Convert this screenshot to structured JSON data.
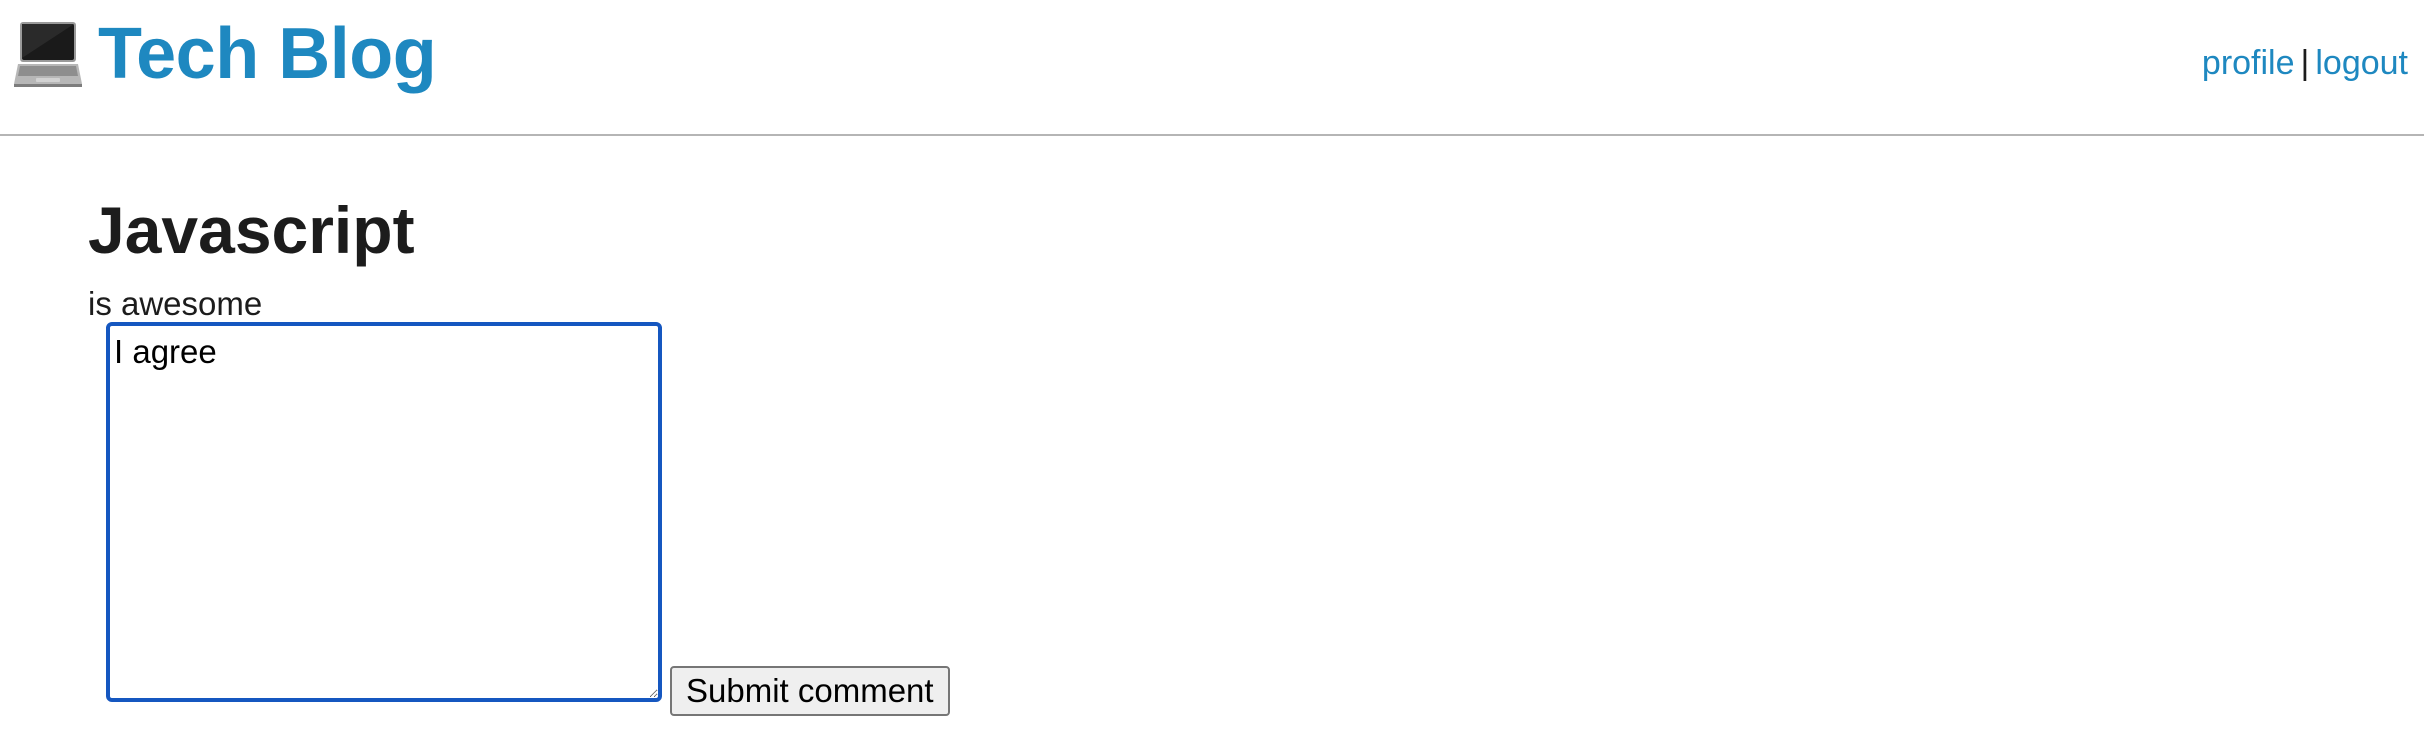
{
  "header": {
    "brand_icon": "laptop-icon",
    "brand_title": "Tech Blog",
    "nav": {
      "profile_label": "profile",
      "separator": "|",
      "logout_label": "logout"
    },
    "colors": {
      "link": "#1e88c0",
      "divider": "#b5b5b5"
    }
  },
  "post": {
    "title": "Javascript",
    "body": "is awesome"
  },
  "comment_form": {
    "textarea_value": "I agree",
    "submit_label": "Submit comment",
    "focus_color": "#1557c0"
  }
}
